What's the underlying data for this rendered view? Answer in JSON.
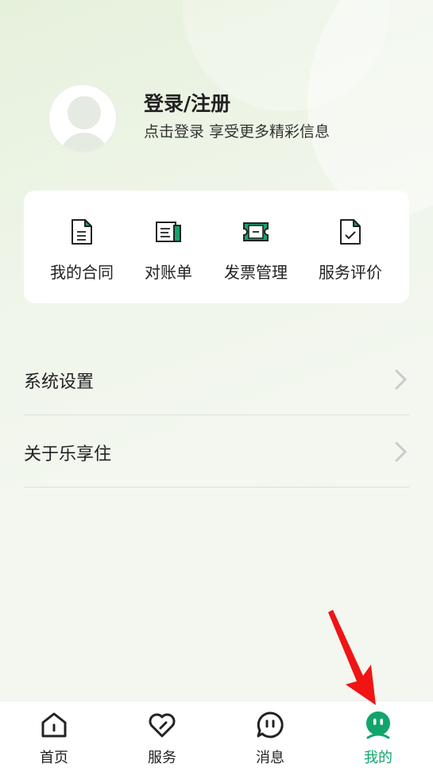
{
  "profile": {
    "login_title": "登录/注册",
    "login_subtitle": "点击登录 享受更多精彩信息"
  },
  "quick_actions": [
    {
      "label": "我的合同",
      "icon": "contract-document-icon"
    },
    {
      "label": "对账单",
      "icon": "statement-icon"
    },
    {
      "label": "发票管理",
      "icon": "invoice-ticket-icon"
    },
    {
      "label": "服务评价",
      "icon": "service-rating-icon"
    }
  ],
  "menu": [
    {
      "label": "系统设置"
    },
    {
      "label": "关于乐享住"
    }
  ],
  "tabbar": [
    {
      "label": "首页",
      "icon": "home-icon",
      "active": false
    },
    {
      "label": "服务",
      "icon": "heart-service-icon",
      "active": false
    },
    {
      "label": "消息",
      "icon": "message-bubble-icon",
      "active": false
    },
    {
      "label": "我的",
      "icon": "profile-face-icon",
      "active": true
    }
  ],
  "colors": {
    "accent_green": "#12a56b",
    "annotation_red": "#f01414"
  }
}
